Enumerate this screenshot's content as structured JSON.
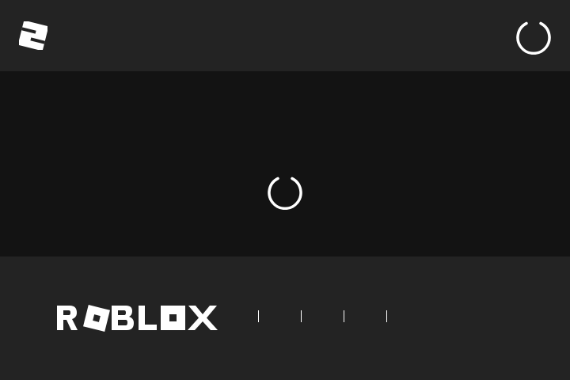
{
  "brand": {
    "wordmark": "ROBLOX",
    "icon": "roblox-tilted-square-icon",
    "color": "#ffffff"
  },
  "colors": {
    "header_bg": "#232323",
    "main_bg": "#131313",
    "footer_bg": "#232323",
    "spinner": "#ffffff"
  },
  "header": {
    "spinner_icon": "loading-spinner-icon"
  },
  "main": {
    "spinner_icon": "loading-spinner-icon"
  },
  "footer": {
    "links": [
      "",
      "",
      "",
      ""
    ]
  }
}
